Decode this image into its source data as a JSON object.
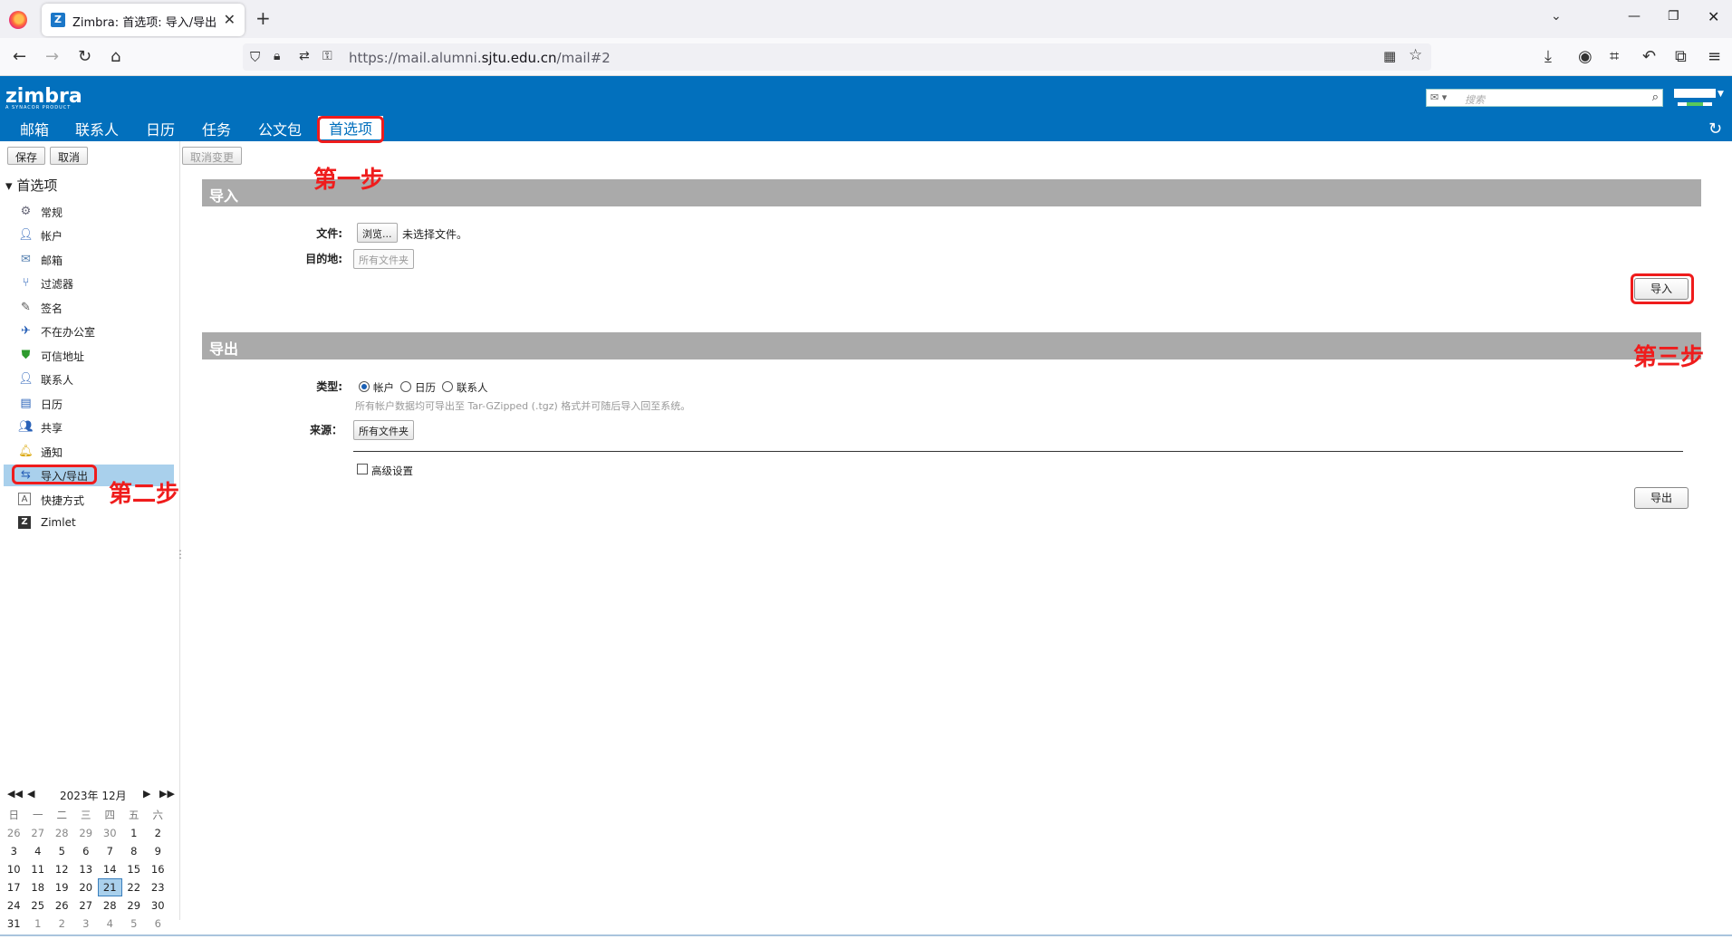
{
  "browser": {
    "tab_title": "Zimbra: 首选项: 导入/导出",
    "url_prefix": "https://mail.alumni.",
    "url_domain": "sjtu.edu.cn",
    "url_suffix": "/mail#2"
  },
  "zimbra": {
    "logo": "zimbra",
    "logo_sub": "A SYNACOR PRODUCT",
    "search_placeholder": "搜索",
    "apps": [
      "邮箱",
      "联系人",
      "日历",
      "任务",
      "公文包",
      "首选项"
    ]
  },
  "toolbar": {
    "save": "保存",
    "cancel": "取消",
    "undo_changes": "取消变更"
  },
  "sidebar": {
    "root": "首选项",
    "items": [
      {
        "label": "常规",
        "icon": "gear-icon"
      },
      {
        "label": "帐户",
        "icon": "account-icon"
      },
      {
        "label": "邮箱",
        "icon": "mail-icon"
      },
      {
        "label": "过滤器",
        "icon": "filter-icon"
      },
      {
        "label": "签名",
        "icon": "signature-icon"
      },
      {
        "label": "不在办公室",
        "icon": "out-of-office-icon"
      },
      {
        "label": "可信地址",
        "icon": "shield-icon"
      },
      {
        "label": "联系人",
        "icon": "contact-icon"
      },
      {
        "label": "日历",
        "icon": "calendar-icon"
      },
      {
        "label": "共享",
        "icon": "share-icon"
      },
      {
        "label": "通知",
        "icon": "bell-icon"
      },
      {
        "label": "导入/导出",
        "icon": "import-export-icon"
      },
      {
        "label": "快捷方式",
        "icon": "shortcut-icon"
      },
      {
        "label": "Zimlet",
        "icon": "zimlet-icon"
      }
    ]
  },
  "calendar": {
    "title": "2023年 12月",
    "weekdays": [
      "日",
      "一",
      "二",
      "三",
      "四",
      "五",
      "六"
    ],
    "weeks": [
      [
        "26",
        "27",
        "28",
        "29",
        "30",
        "1",
        "2"
      ],
      [
        "3",
        "4",
        "5",
        "6",
        "7",
        "8",
        "9"
      ],
      [
        "10",
        "11",
        "12",
        "13",
        "14",
        "15",
        "16"
      ],
      [
        "17",
        "18",
        "19",
        "20",
        "21",
        "22",
        "23"
      ],
      [
        "24",
        "25",
        "26",
        "27",
        "28",
        "29",
        "30"
      ],
      [
        "31",
        "1",
        "2",
        "3",
        "4",
        "5",
        "6"
      ]
    ],
    "today": "21"
  },
  "import": {
    "header": "导入",
    "file_label": "文件:",
    "browse": "浏览...",
    "no_file": "未选择文件。",
    "dest_label": "目的地:",
    "dest_value": "所有文件夹",
    "import_button": "导入"
  },
  "export": {
    "header": "导出",
    "type_label": "类型:",
    "types": [
      "帐户",
      "日历",
      "联系人"
    ],
    "hint": "所有帐户数据均可导出至 Tar-GZipped (.tgz) 格式并可随后导入回至系统。",
    "source_label": "来源：",
    "source_value": "所有文件夹",
    "advanced": "高级设置",
    "export_button": "导出"
  },
  "annotations": {
    "step1": "第一步",
    "step2": "第二步",
    "step3": "第三步"
  }
}
